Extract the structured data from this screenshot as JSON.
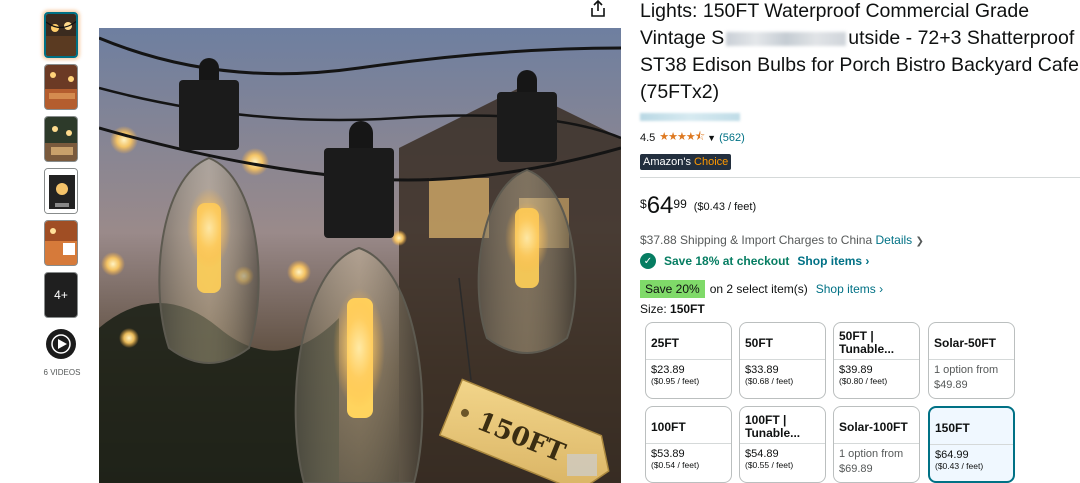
{
  "thumbnails": {
    "more_label": "4+",
    "videos_label": "6 VIDEOS"
  },
  "image_tag_text": "150FT",
  "product": {
    "title_part1": "Lights: 150FT Waterproof Commercial Grade Vintage S",
    "title_part2": "utside - 72+3 Shatterproof ST38 Edison Bulbs for Porch Bistro Backyard Cafe (75FTx2)",
    "rating": "4.5",
    "stars": "★★★★⯪",
    "review_count": "(562)",
    "badge_prefix": "Amazon's",
    "badge_suffix": " Choice"
  },
  "price": {
    "symbol": "$",
    "whole": "64",
    "fraction": "99",
    "unit": "($0.43 / feet)"
  },
  "shipping": {
    "text": "$37.88 Shipping & Import Charges to China",
    "details_label": "Details"
  },
  "checkout": {
    "save_text": "Save 18% at checkout",
    "shop_label": "Shop items ›"
  },
  "coupon": {
    "badge": "Save 20%",
    "text": "on 2 select item(s)",
    "link": "Shop items ›"
  },
  "size": {
    "label": "Size:",
    "selected": "150FT",
    "options": [
      {
        "name": "25FT",
        "price": "$23.89",
        "unit": "($0.95 / feet)"
      },
      {
        "name": "50FT",
        "price": "$33.89",
        "unit": "($0.68 / feet)"
      },
      {
        "name": "50FT | Tunable...",
        "price": "$39.89",
        "unit": "($0.80 / feet)"
      },
      {
        "name": "Solar-50FT",
        "price": "1 option from",
        "unit": "$49.89"
      },
      {
        "name": "100FT",
        "price": "$53.89",
        "unit": "($0.54 / feet)"
      },
      {
        "name": "100FT | Tunable...",
        "price": "$54.89",
        "unit": "($0.55 / feet)"
      },
      {
        "name": "Solar-100FT",
        "price": "1 option from",
        "unit": "$69.89"
      },
      {
        "name": "150FT",
        "price": "$64.99",
        "unit": "($0.43 / feet)"
      }
    ]
  },
  "colors": {
    "link": "#007185",
    "star": "#de7921",
    "success": "#067d62",
    "coupon": "#7fda69",
    "badge_bg": "#232f3e"
  },
  "icons": {
    "share": "share-icon",
    "play": "play-icon",
    "check": "check-circle-icon",
    "chevron": "chevron-down-icon"
  }
}
